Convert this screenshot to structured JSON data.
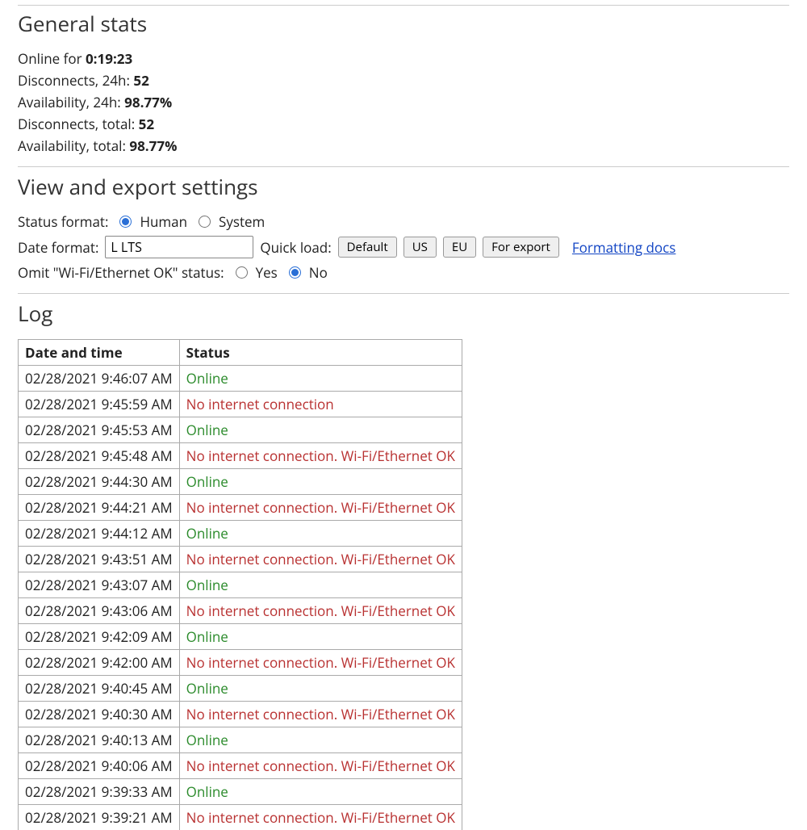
{
  "sections": {
    "general_stats": "General stats",
    "view_export": "View and export settings",
    "log": "Log"
  },
  "stats": {
    "online_for_label": "Online for ",
    "online_for_value": "0:19:23",
    "disc24_label": "Disconnects, 24h: ",
    "disc24_value": "52",
    "avail24_label": "Availability, 24h: ",
    "avail24_value": "98.77%",
    "disc_total_label": "Disconnects, total: ",
    "disc_total_value": "52",
    "avail_total_label": "Availability, total: ",
    "avail_total_value": "98.77%"
  },
  "settings": {
    "status_format_label": "Status format:",
    "status_human": "Human",
    "status_system": "System",
    "date_format_label": "Date format:",
    "date_format_value": "L LTS",
    "quick_load_label": "Quick load:",
    "btn_default": "Default",
    "btn_us": "US",
    "btn_eu": "EU",
    "btn_export": "For export",
    "formatting_docs": "Formatting docs",
    "omit_label": "Omit \"Wi-Fi/Ethernet OK\" status:",
    "omit_yes": "Yes",
    "omit_no": "No"
  },
  "log_headers": {
    "date": "Date and time",
    "status": "Status"
  },
  "status_text": {
    "online": "Online",
    "noic": "No internet connection",
    "noic_ok": "No internet connection. Wi-Fi/Ethernet OK"
  },
  "log_rows": [
    {
      "t": "02/28/2021 9:46:07 AM",
      "s": "online"
    },
    {
      "t": "02/28/2021 9:45:59 AM",
      "s": "noic"
    },
    {
      "t": "02/28/2021 9:45:53 AM",
      "s": "online"
    },
    {
      "t": "02/28/2021 9:45:48 AM",
      "s": "noic_ok"
    },
    {
      "t": "02/28/2021 9:44:30 AM",
      "s": "online"
    },
    {
      "t": "02/28/2021 9:44:21 AM",
      "s": "noic_ok"
    },
    {
      "t": "02/28/2021 9:44:12 AM",
      "s": "online"
    },
    {
      "t": "02/28/2021 9:43:51 AM",
      "s": "noic_ok"
    },
    {
      "t": "02/28/2021 9:43:07 AM",
      "s": "online"
    },
    {
      "t": "02/28/2021 9:43:06 AM",
      "s": "noic_ok"
    },
    {
      "t": "02/28/2021 9:42:09 AM",
      "s": "online"
    },
    {
      "t": "02/28/2021 9:42:00 AM",
      "s": "noic_ok"
    },
    {
      "t": "02/28/2021 9:40:45 AM",
      "s": "online"
    },
    {
      "t": "02/28/2021 9:40:30 AM",
      "s": "noic_ok"
    },
    {
      "t": "02/28/2021 9:40:13 AM",
      "s": "online"
    },
    {
      "t": "02/28/2021 9:40:06 AM",
      "s": "noic_ok"
    },
    {
      "t": "02/28/2021 9:39:33 AM",
      "s": "online"
    },
    {
      "t": "02/28/2021 9:39:21 AM",
      "s": "noic_ok"
    }
  ]
}
